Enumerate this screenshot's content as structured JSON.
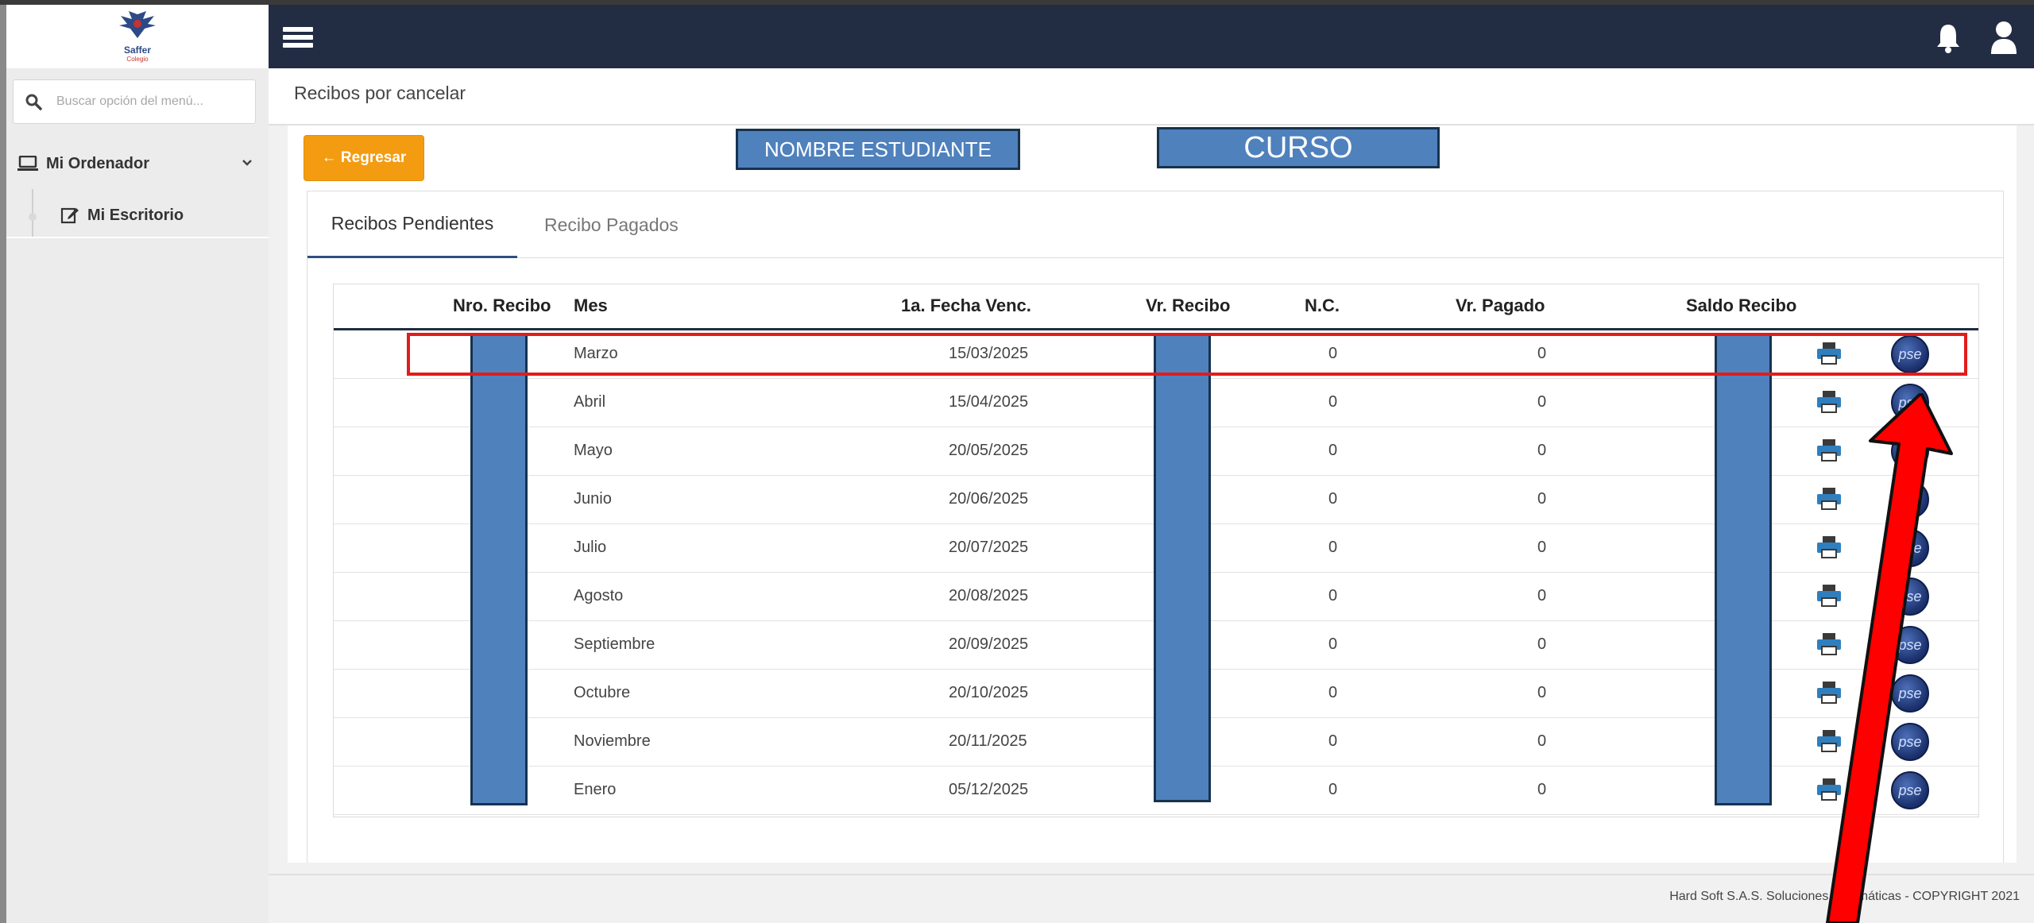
{
  "app": {
    "logo_text": "Saffer",
    "logo_sub": "Colegio"
  },
  "topbar": {
    "menu_icon": "hamburger-icon",
    "notifications_icon": "bell-icon",
    "user_icon": "user-icon"
  },
  "sidebar": {
    "search_placeholder": "Buscar opción del menú...",
    "items": [
      {
        "label": "Mi Ordenador",
        "icon": "laptop-icon"
      },
      {
        "label": "Mi Escritorio",
        "icon": "edit-icon"
      }
    ]
  },
  "header": {
    "title": "Recibos por cancelar"
  },
  "actions": {
    "back_label": "← Regresar"
  },
  "student": {
    "name_label": "NOMBRE ESTUDIANTE",
    "course_label": "CURSO"
  },
  "tabs": [
    {
      "label": "Recibos Pendientes"
    },
    {
      "label": "Recibo Pagados"
    }
  ],
  "table": {
    "headers": [
      "Nro. Recibo",
      "Mes",
      "1a. Fecha Venc.",
      "Vr. Recibo",
      "N.C.",
      "Vr. Pagado",
      "Saldo Recibo"
    ],
    "rows": [
      {
        "mes": "Marzo",
        "fecha": "15/03/2025",
        "nc": "0",
        "pagado": "0"
      },
      {
        "mes": "Abril",
        "fecha": "15/04/2025",
        "nc": "0",
        "pagado": "0"
      },
      {
        "mes": "Mayo",
        "fecha": "20/05/2025",
        "nc": "0",
        "pagado": "0"
      },
      {
        "mes": "Junio",
        "fecha": "20/06/2025",
        "nc": "0",
        "pagado": "0"
      },
      {
        "mes": "Julio",
        "fecha": "20/07/2025",
        "nc": "0",
        "pagado": "0"
      },
      {
        "mes": "Agosto",
        "fecha": "20/08/2025",
        "nc": "0",
        "pagado": "0"
      },
      {
        "mes": "Septiembre",
        "fecha": "20/09/2025",
        "nc": "0",
        "pagado": "0"
      },
      {
        "mes": "Octubre",
        "fecha": "20/10/2025",
        "nc": "0",
        "pagado": "0"
      },
      {
        "mes": "Noviembre",
        "fecha": "20/11/2025",
        "nc": "0",
        "pagado": "0"
      },
      {
        "mes": "Enero",
        "fecha": "05/12/2025",
        "nc": "0",
        "pagado": "0"
      }
    ],
    "pay_label": "pse"
  },
  "footer": {
    "text": "Hard Soft S.A.S. Soluciones Informáticas - COPYRIGHT 2021"
  },
  "colors": {
    "topbar": "#222d44",
    "back_button": "#f39c12",
    "redaction": "#4f81bd",
    "annotation": "#e31b1b"
  }
}
